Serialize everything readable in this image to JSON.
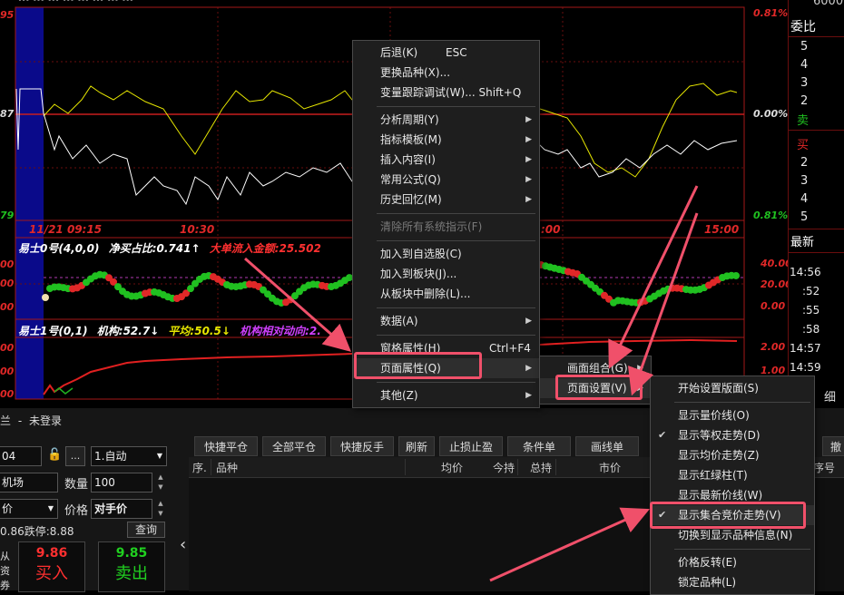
{
  "chart_header": {
    "text": "··· ··· ··· ··· ··· ··· ··· ···"
  },
  "main_chart": {
    "y_left": [
      "95",
      "87",
      "79"
    ],
    "y_right": [
      "0.81%",
      "0.00%",
      "0.81%"
    ],
    "time_labels": [
      "11/21 09:15",
      "10:30",
      ":00",
      "15:00"
    ]
  },
  "indicator0": {
    "name": "易士0号(4,0,0)",
    "value1": "净买占比:0.741↑",
    "value2": "大单流入金额:25.502",
    "y_left": [
      "00",
      "00",
      "00"
    ],
    "y_right": [
      "40.00",
      "20.00",
      "0.00"
    ]
  },
  "indicator1": {
    "name": "易士1号(0,1)",
    "value1": "机构:52.7↓",
    "value2": "平均:50.5↓",
    "value3": "机构相对动向:2.",
    "y_left": [
      "00",
      "00",
      "00"
    ],
    "y_right": [
      "2.00",
      "1.00"
    ]
  },
  "side_panel": {
    "title": "委比",
    "sell_label": "卖",
    "buy_label": "买",
    "sell_levels": [
      "5",
      "4",
      "3",
      "2"
    ],
    "buy_levels": [
      "2",
      "3",
      "4",
      "5"
    ],
    "top_value": "6000",
    "latest_label": "最新",
    "times": [
      "14:56",
      ":52",
      ":55",
      ":58",
      "14:57",
      "14:59"
    ],
    "detail_label": "细"
  },
  "context_menu": {
    "items": [
      {
        "label": "后退(K)",
        "shortcut": "ESC"
      },
      {
        "label": "更换品种(X)..."
      },
      {
        "label": "变量跟踪调试(W)... Shift+Q"
      },
      {
        "label": "分析周期(Y)"
      },
      {
        "label": "指标模板(M)"
      },
      {
        "label": "插入内容(I)"
      },
      {
        "label": "常用公式(Q)"
      },
      {
        "label": "历史回忆(M)"
      },
      {
        "label": "清除所有系统指示(F)"
      },
      {
        "label": "加入到自选股(C)"
      },
      {
        "label": "加入到板块(J)..."
      },
      {
        "label": "从板块中删除(L)..."
      },
      {
        "label": "数据(A)"
      },
      {
        "label": "窗格属性(H)",
        "shortcut": "Ctrl+F4"
      },
      {
        "label": "页面属性(Q)"
      },
      {
        "label": "其他(Z)"
      }
    ]
  },
  "submenu1": {
    "items": [
      {
        "label": "画面组合(G)"
      },
      {
        "label": "页面设置(V)"
      }
    ]
  },
  "submenu2": {
    "items": [
      {
        "label": "开始设置版面(S)"
      },
      {
        "label": "显示量价线(O)"
      },
      {
        "label": "显示等权走势(D)"
      },
      {
        "label": "显示均价走势(Z)"
      },
      {
        "label": "显示红绿柱(T)"
      },
      {
        "label": "显示最新价线(W)"
      },
      {
        "label": "显示集合竞价走势(V)"
      },
      {
        "label": "切换到显示品种信息(N)"
      },
      {
        "label": "价格反转(E)"
      },
      {
        "label": "锁定品种(L)"
      }
    ],
    "check": "✔"
  },
  "trade_panel": {
    "status": "未登录",
    "status_prefix": "兰",
    "account_fragment": "04",
    "more_label": "...",
    "mode_select": "1.自动",
    "symbol_fragment": "机场",
    "qty_label": "数量",
    "qty_value": "100",
    "price_type_fragment": "价",
    "price_label": "价格",
    "price_value": "对手价",
    "limit_text": "0.86跌停:8.88",
    "query_button": "查询",
    "buy_price": "9.86",
    "sell_price": "9.85",
    "buy_label": "买入",
    "sell_label": "卖出",
    "left_fragments": [
      "从",
      "资",
      "券"
    ]
  },
  "toolbar": {
    "buttons": [
      "快捷平仓",
      "全部平仓",
      "快捷反手",
      "刷新",
      "止损止盈",
      "条件单",
      "画线单"
    ],
    "right_button": "撤"
  },
  "positions_table": {
    "headers": [
      "序.",
      "品种",
      "均价",
      "今持",
      "总持",
      "市价",
      "序号"
    ]
  },
  "collapse_arrow": "‹",
  "colors": {
    "accent_highlight": "#f0506a",
    "chart_red": "#c81e1e",
    "chart_yellow": "#e6e600"
  }
}
